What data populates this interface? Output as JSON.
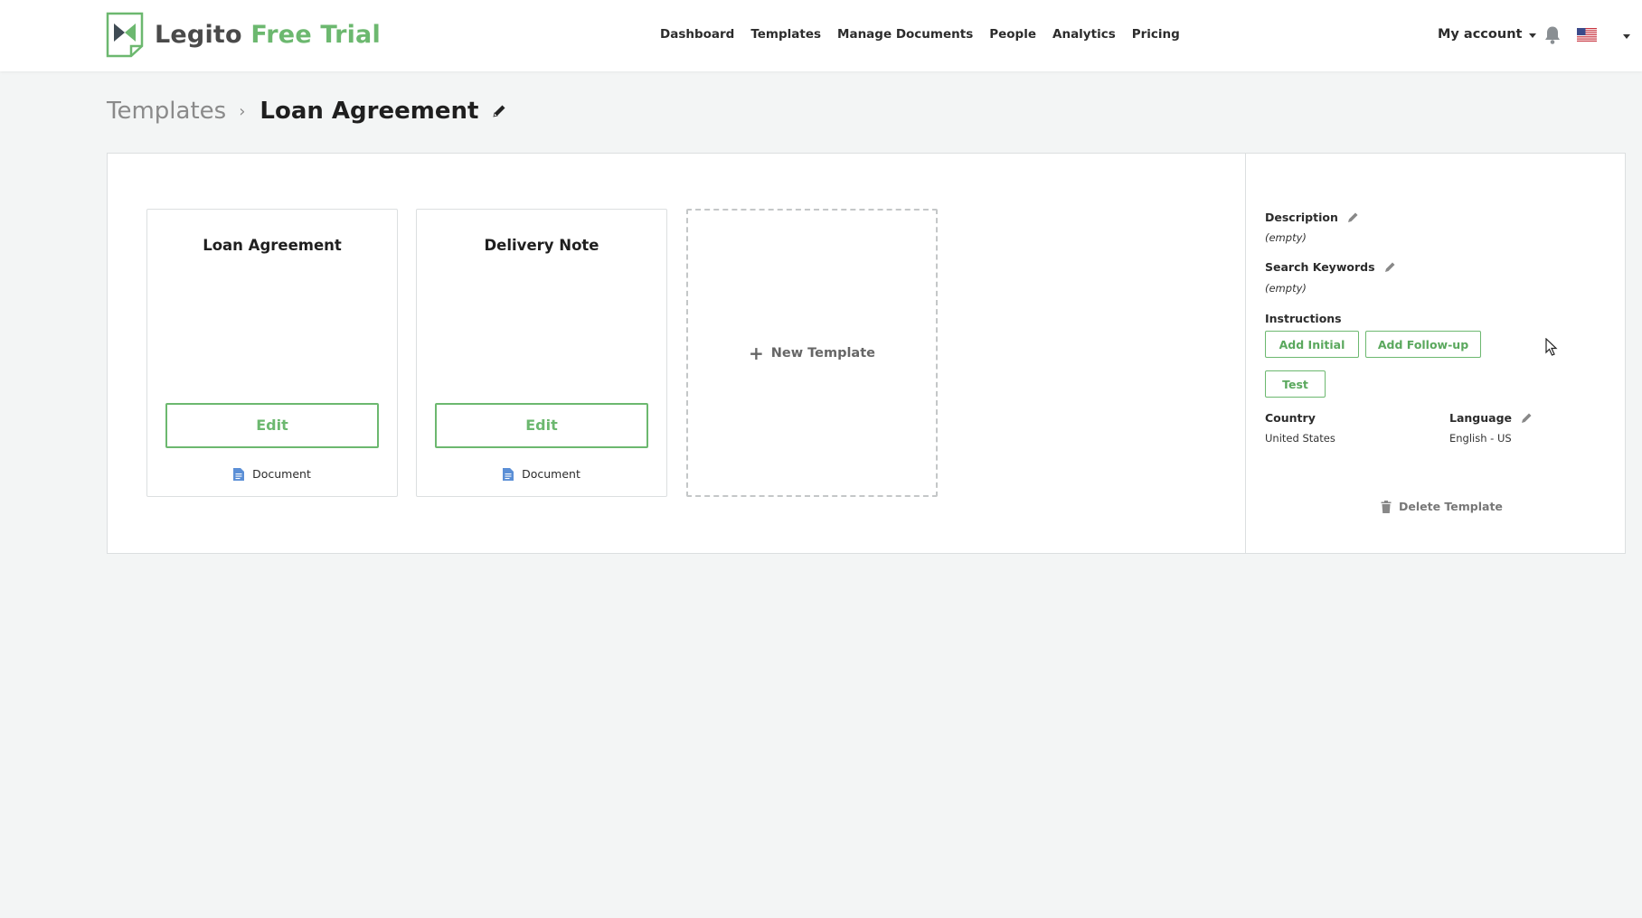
{
  "header": {
    "logo": {
      "brand": "Legito",
      "accent": "Free Trial"
    },
    "nav": [
      {
        "label": "Dashboard"
      },
      {
        "label": "Templates"
      },
      {
        "label": "Manage Documents"
      },
      {
        "label": "People"
      },
      {
        "label": "Analytics"
      },
      {
        "label": "Pricing"
      }
    ],
    "account_label": "My account"
  },
  "breadcrumb": {
    "parent": "Templates",
    "separator": "›",
    "current": "Loan Agreement"
  },
  "cards": [
    {
      "title": "Loan Agreement",
      "edit_label": "Edit",
      "type": "Document"
    },
    {
      "title": "Delivery Note",
      "edit_label": "Edit",
      "type": "Document"
    }
  ],
  "new_template": {
    "plus": "+",
    "label": "New Template"
  },
  "side": {
    "description": {
      "label": "Description",
      "value": "(empty)"
    },
    "keywords": {
      "label": "Search Keywords",
      "value": "(empty)"
    },
    "instructions": {
      "label": "Instructions",
      "add_initial": "Add Initial",
      "add_followup": "Add Follow-up",
      "test": "Test"
    },
    "country": {
      "label": "Country",
      "value": "United States"
    },
    "language": {
      "label": "Language",
      "value": "English - US"
    },
    "delete_label": "Delete Template"
  },
  "colors": {
    "accent": "#6cb86f",
    "background": "#f3f5f5",
    "border": "#dcdfe0"
  }
}
